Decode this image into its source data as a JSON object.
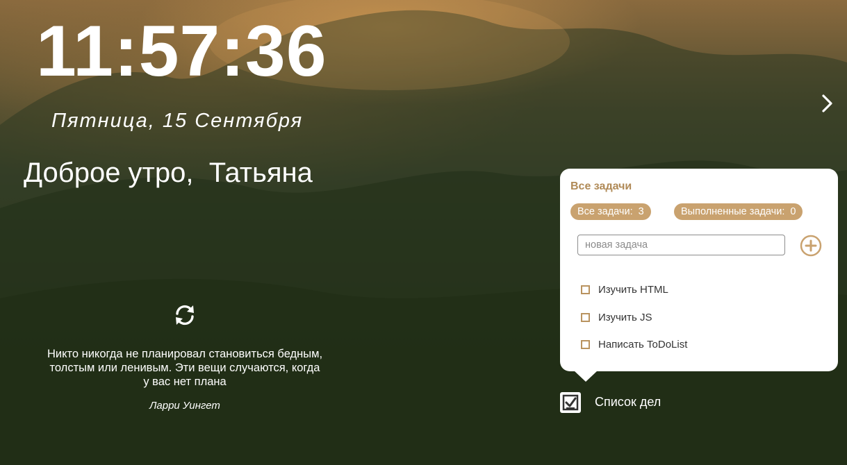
{
  "clock": "11:57:36",
  "date": "Пятница, 15 Сентября",
  "greeting": "Доброе утро,  Татьяна",
  "quote": {
    "text": "Никто никогда не планировал становиться бедным, толстым или ленивым. Эти вещи случаются, когда у вас нет плана",
    "author": "Ларри Уингет"
  },
  "todo": {
    "title": "Все задачи",
    "all_label": "Все задачи:",
    "all_count": "3",
    "done_label": "Выполненные задачи:",
    "done_count": "0",
    "input_placeholder": "новая задача",
    "tasks": [
      {
        "label": "Изучить HTML",
        "done": false
      },
      {
        "label": "Изучить JS",
        "done": false
      },
      {
        "label": "Написать ToDoList",
        "done": false
      }
    ],
    "toggle_label": "Список дел"
  },
  "colors": {
    "accent": "#c9a26f",
    "accent_text": "#b08a57",
    "panel": "#ffffff"
  },
  "icons": {
    "next": "chevron-right-icon",
    "refresh": "refresh-icon",
    "add": "plus-circle-icon",
    "todo": "checklist-icon"
  }
}
